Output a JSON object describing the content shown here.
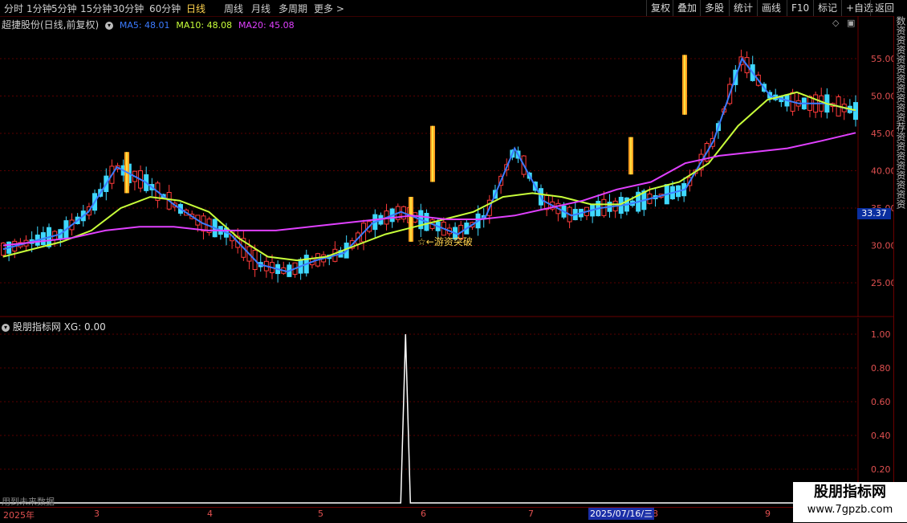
{
  "topbar": {
    "tabs": [
      "分时",
      "1分钟",
      "5分钟",
      "15分钟",
      "30分钟",
      "60分钟",
      "日线",
      "周线",
      "月线",
      "多周期",
      "更多"
    ],
    "active_tab": "日线",
    "more_suffix": ">",
    "right_buttons": [
      "复权",
      "叠加",
      "多股",
      "统计",
      "画线",
      "F10",
      "标记",
      "+自选",
      "返回"
    ]
  },
  "main_panel": {
    "stock_label": "超捷股份(日线,前复权)",
    "ma5_label": "MA5: 48.01",
    "ma10_label": "MA10: 48.08",
    "ma20_label": "MA20: 45.08",
    "current_price": "33.37",
    "annotation": "☆←游资突破",
    "price_ticks": [
      "55.00",
      "50.00",
      "45.00",
      "40.00",
      "35.00",
      "30.00",
      "25.00"
    ]
  },
  "indicator_panel": {
    "title": "股朋指标网 XG: 0.00",
    "ticks": [
      "1.00",
      "0.80",
      "0.60",
      "0.40",
      "0.20"
    ],
    "future_note": "用到未来数据"
  },
  "date_axis": {
    "labels": [
      "2025年",
      "3",
      "4",
      "5",
      "6",
      "7",
      "8",
      "9"
    ],
    "active_date": "2025/07/16/三"
  },
  "watermark": {
    "line1": "股朋指标网",
    "line2": "www.7gpzb.com"
  },
  "sidebar_text": "数资资资资资资资资资资荐资资资资资资资资",
  "colors": {
    "ma5": "#3b7bff",
    "ma10": "#c8ff3a",
    "ma20": "#e040ff",
    "up": "#ff3b3b",
    "down": "#3fd8ff",
    "grid": "#6a0000"
  },
  "chart_data": [
    {
      "type": "candlestick",
      "title": "超捷股份(日线,前复权)",
      "ylim": [
        20,
        60
      ],
      "series": [
        {
          "name": "MA5",
          "y": [
            29.5,
            30.5,
            31.5,
            34.5,
            40.5,
            38.5,
            35.5,
            33.0,
            31.5,
            27.5,
            26.5,
            28.0,
            29.0,
            33.0,
            34.5,
            33.0,
            31.5,
            34.0,
            43.0,
            36.0,
            34.0,
            35.0,
            35.5,
            36.5,
            37.5,
            44.0,
            55.0,
            50.0,
            49.0,
            49.0,
            48.0
          ]
        },
        {
          "name": "MA10",
          "y": [
            28.5,
            29.5,
            30.5,
            32.0,
            35.0,
            36.5,
            36.0,
            34.5,
            31.0,
            28.5,
            28.0,
            28.5,
            30.0,
            31.5,
            32.5,
            33.5,
            34.5,
            36.5,
            37.0,
            36.5,
            35.5,
            35.5,
            37.5,
            38.5,
            41.0,
            46.0,
            49.5,
            50.5,
            49.0,
            48.08
          ]
        },
        {
          "name": "MA20",
          "y": [
            30.0,
            30.5,
            31.0,
            32.0,
            32.5,
            32.5,
            32.0,
            32.0,
            32.0,
            32.5,
            33.0,
            33.5,
            34.0,
            33.5,
            33.5,
            34.0,
            35.0,
            36.0,
            37.5,
            38.5,
            41.0,
            42.0,
            42.5,
            43.0,
            44.0,
            45.08
          ]
        }
      ],
      "annotations": [
        "☆←游资突破"
      ],
      "last_price": 33.37
    },
    {
      "type": "line",
      "title": "股朋指标网 XG: 0.00",
      "ylim": [
        0,
        1.0
      ],
      "series": [
        {
          "name": "XG",
          "spike_at_fraction": 0.472,
          "peak": 1.0
        }
      ]
    }
  ]
}
